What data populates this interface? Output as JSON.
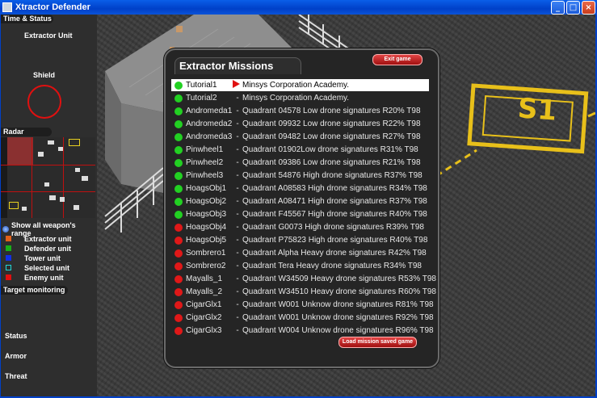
{
  "window": {
    "title": "Xtractor Defender",
    "min": "_",
    "max": "□",
    "close": "×"
  },
  "side": {
    "time_status": "Time & Status",
    "extractor_unit": "Extractor Unit",
    "shield": "Shield",
    "radar": "Radar",
    "show_range": "Show all weapon's range",
    "legend": [
      {
        "label": "Extractor unit",
        "color": "#e0601a"
      },
      {
        "label": "Defender unit",
        "color": "#18b018"
      },
      {
        "label": "Tower unit",
        "color": "#1030e8"
      },
      {
        "label": "Selected unit",
        "color": "#20d8d8"
      },
      {
        "label": "Enemy unit",
        "color": "#e01010"
      }
    ],
    "target_monitoring": "Target monitoring",
    "status": "Status",
    "armor": "Armor",
    "threat": "Threat"
  },
  "map": {
    "sign": "S1"
  },
  "dialog": {
    "title": "Extractor Missions",
    "exit": "Exit game",
    "load": "Load mission saved game",
    "missions": [
      {
        "name": "Tutorial1",
        "sep": "",
        "desc": "Minsys Corporation Academy.",
        "status": "green",
        "selected": true
      },
      {
        "name": "Tutorial2",
        "sep": "-",
        "desc": "Minsys Corporation Academy.",
        "status": "green",
        "selected": false
      },
      {
        "name": "Andromeda1",
        "sep": "-",
        "desc": "Quadrant 04578 Low drone signatures R20% T98",
        "status": "green",
        "selected": false
      },
      {
        "name": "Andromeda2",
        "sep": "-",
        "desc": "Quadrant 09932 Low drone signatures R22% T98",
        "status": "green",
        "selected": false
      },
      {
        "name": "Andromeda3",
        "sep": "-",
        "desc": "Quadrant 09482 Low drone signatures R27% T98",
        "status": "green",
        "selected": false
      },
      {
        "name": "Pinwheel1",
        "sep": "-",
        "desc": "Quadrant 01902Low drone signatures R31% T98",
        "status": "green",
        "selected": false
      },
      {
        "name": "Pinwheel2",
        "sep": "-",
        "desc": "Quadrant 09386 Low drone signatures R21% T98",
        "status": "green",
        "selected": false
      },
      {
        "name": "Pinwheel3",
        "sep": "-",
        "desc": "Quadrant 54876 High drone signatures R37% T98",
        "status": "green",
        "selected": false
      },
      {
        "name": "HoagsObj1",
        "sep": "-",
        "desc": "Quadrant A08583 High drone signatures R34% T98",
        "status": "green",
        "selected": false
      },
      {
        "name": "HoagsObj2",
        "sep": "-",
        "desc": "Quadrant A08471 High drone signatures R37% T98",
        "status": "green",
        "selected": false
      },
      {
        "name": "HoagsObj3",
        "sep": "-",
        "desc": "Quadrant F45567 High drone signatures R40% T98",
        "status": "green",
        "selected": false
      },
      {
        "name": "HoagsObj4",
        "sep": "-",
        "desc": "Quadrant G0073 High drone signatures R39% T98",
        "status": "red",
        "selected": false
      },
      {
        "name": "HoagsObj5",
        "sep": "-",
        "desc": "Quadrant P75823 High drone signatures R40% T98",
        "status": "red",
        "selected": false
      },
      {
        "name": "Sombrero1",
        "sep": "-",
        "desc": "Quadrant Alpha Heavy drone signatures R42% T98",
        "status": "red",
        "selected": false
      },
      {
        "name": "Sombrero2",
        "sep": "-",
        "desc": "Quadrant Tera Heavy drone signatures R34% T98",
        "status": "red",
        "selected": false
      },
      {
        "name": "Mayalls_1",
        "sep": "-",
        "desc": "Quadrant W34509 Heavy drone signatures R53% T98",
        "status": "red",
        "selected": false
      },
      {
        "name": "Mayalls_2",
        "sep": "-",
        "desc": "Quadrant W34510 Heavy drone signatures R60% T98",
        "status": "red",
        "selected": false
      },
      {
        "name": "CigarGlx1",
        "sep": "-",
        "desc": "Quadrant W001 Unknow drone signatures R81% T98",
        "status": "red",
        "selected": false
      },
      {
        "name": "CigarGlx2",
        "sep": "-",
        "desc": "Quadrant W001 Unknow drone signatures R92% T98",
        "status": "red",
        "selected": false
      },
      {
        "name": "CigarGlx3",
        "sep": "-",
        "desc": "Quadrant W004 Unknow drone signatures R96% T98",
        "status": "red",
        "selected": false
      }
    ]
  },
  "colors": {
    "green": "#22d022",
    "red": "#e01818"
  }
}
